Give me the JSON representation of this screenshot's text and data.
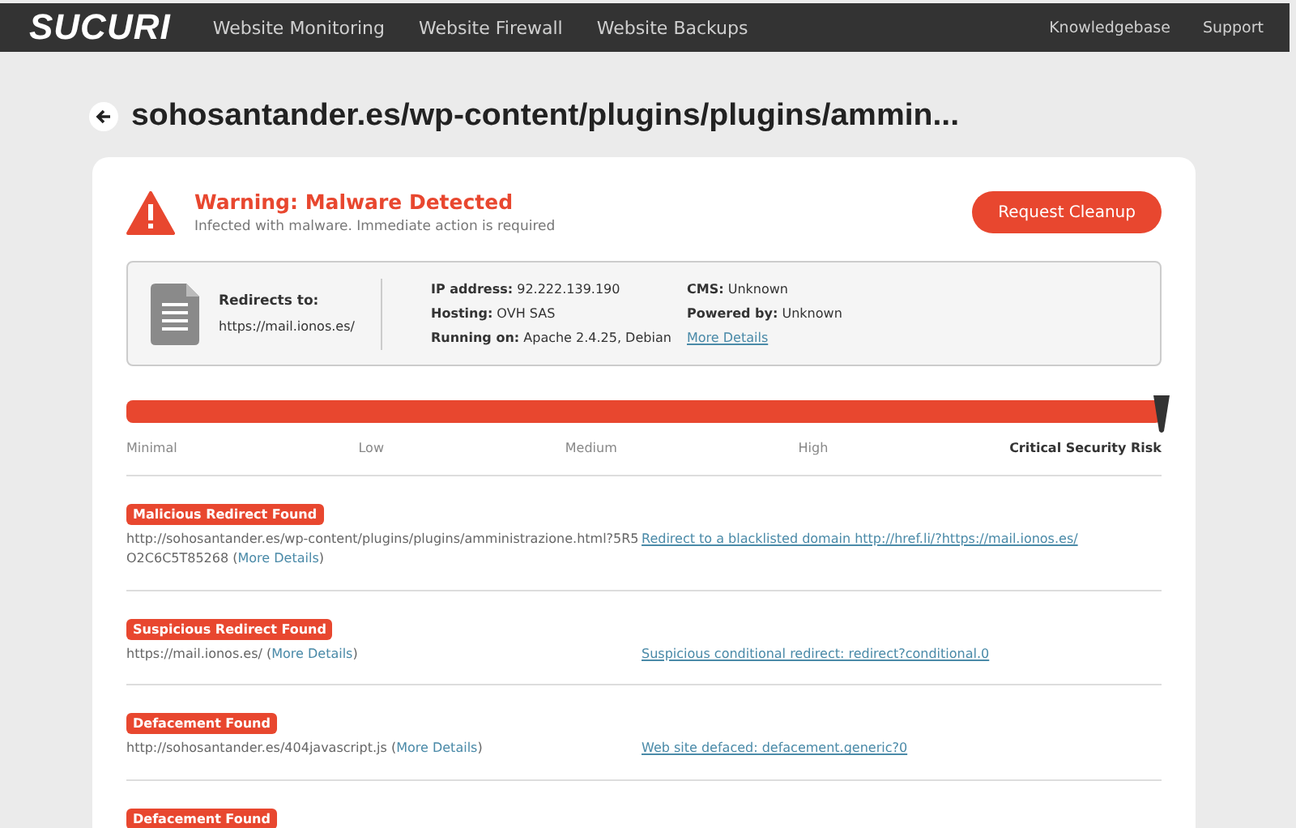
{
  "nav": {
    "logo": "SUCURI",
    "links": [
      {
        "label": "Website Monitoring"
      },
      {
        "label": "Website Firewall"
      },
      {
        "label": "Website Backups"
      }
    ],
    "right_links": [
      {
        "label": "Knowledgebase"
      },
      {
        "label": "Support"
      }
    ]
  },
  "page": {
    "title": "sohosantander.es/wp-content/plugins/plugins/ammin..."
  },
  "alert": {
    "title": "Warning: Malware Detected",
    "subtitle": "Infected with malware. Immediate action is required",
    "button": "Request Cleanup"
  },
  "info": {
    "redirect_label": "Redirects to:",
    "redirect_value": "https://mail.ionos.es/",
    "fields": [
      {
        "label": "IP address:",
        "value": "92.222.139.190"
      },
      {
        "label": "Hosting:",
        "value": "OVH SAS"
      },
      {
        "label": "Running on:",
        "value": "Apache 2.4.25, Debian"
      }
    ],
    "fields_2": [
      {
        "label": "CMS:",
        "value": "Unknown"
      },
      {
        "label": "Powered by:",
        "value": "Unknown"
      }
    ],
    "more_link": "More Details"
  },
  "risk": {
    "level": 1,
    "labels": [
      {
        "text": "Minimal",
        "selected": false
      },
      {
        "text": "Low",
        "selected": false
      },
      {
        "text": "Medium",
        "selected": false
      },
      {
        "text": "High",
        "selected": false
      },
      {
        "text": "Critical Security Risk",
        "selected": true
      }
    ]
  },
  "findings": [
    {
      "badge": "Malicious Redirect Found",
      "url": "http://sohosantander.es/wp-content/plugins/plugins/amministrazione.html?5R5O2C6C5T85268",
      "open": "(",
      "link": "More Details",
      "close": ")",
      "signature": "Redirect to a blacklisted domain http://href.li/?https://mail.ionos.es/"
    },
    {
      "badge": "Suspicious Redirect Found",
      "url": "https://mail.ionos.es/",
      "open": "(",
      "link": "More Details",
      "close": ")",
      "signature": "Suspicious conditional redirect: redirect?conditional.0"
    },
    {
      "badge": "Defacement Found",
      "url": "http://sohosantander.es/404javascript.js",
      "open": "(",
      "link": "More Details",
      "close": ")",
      "signature": "Web site defaced: defacement.generic?0"
    },
    {
      "badge": "Defacement Found"
    }
  ]
}
